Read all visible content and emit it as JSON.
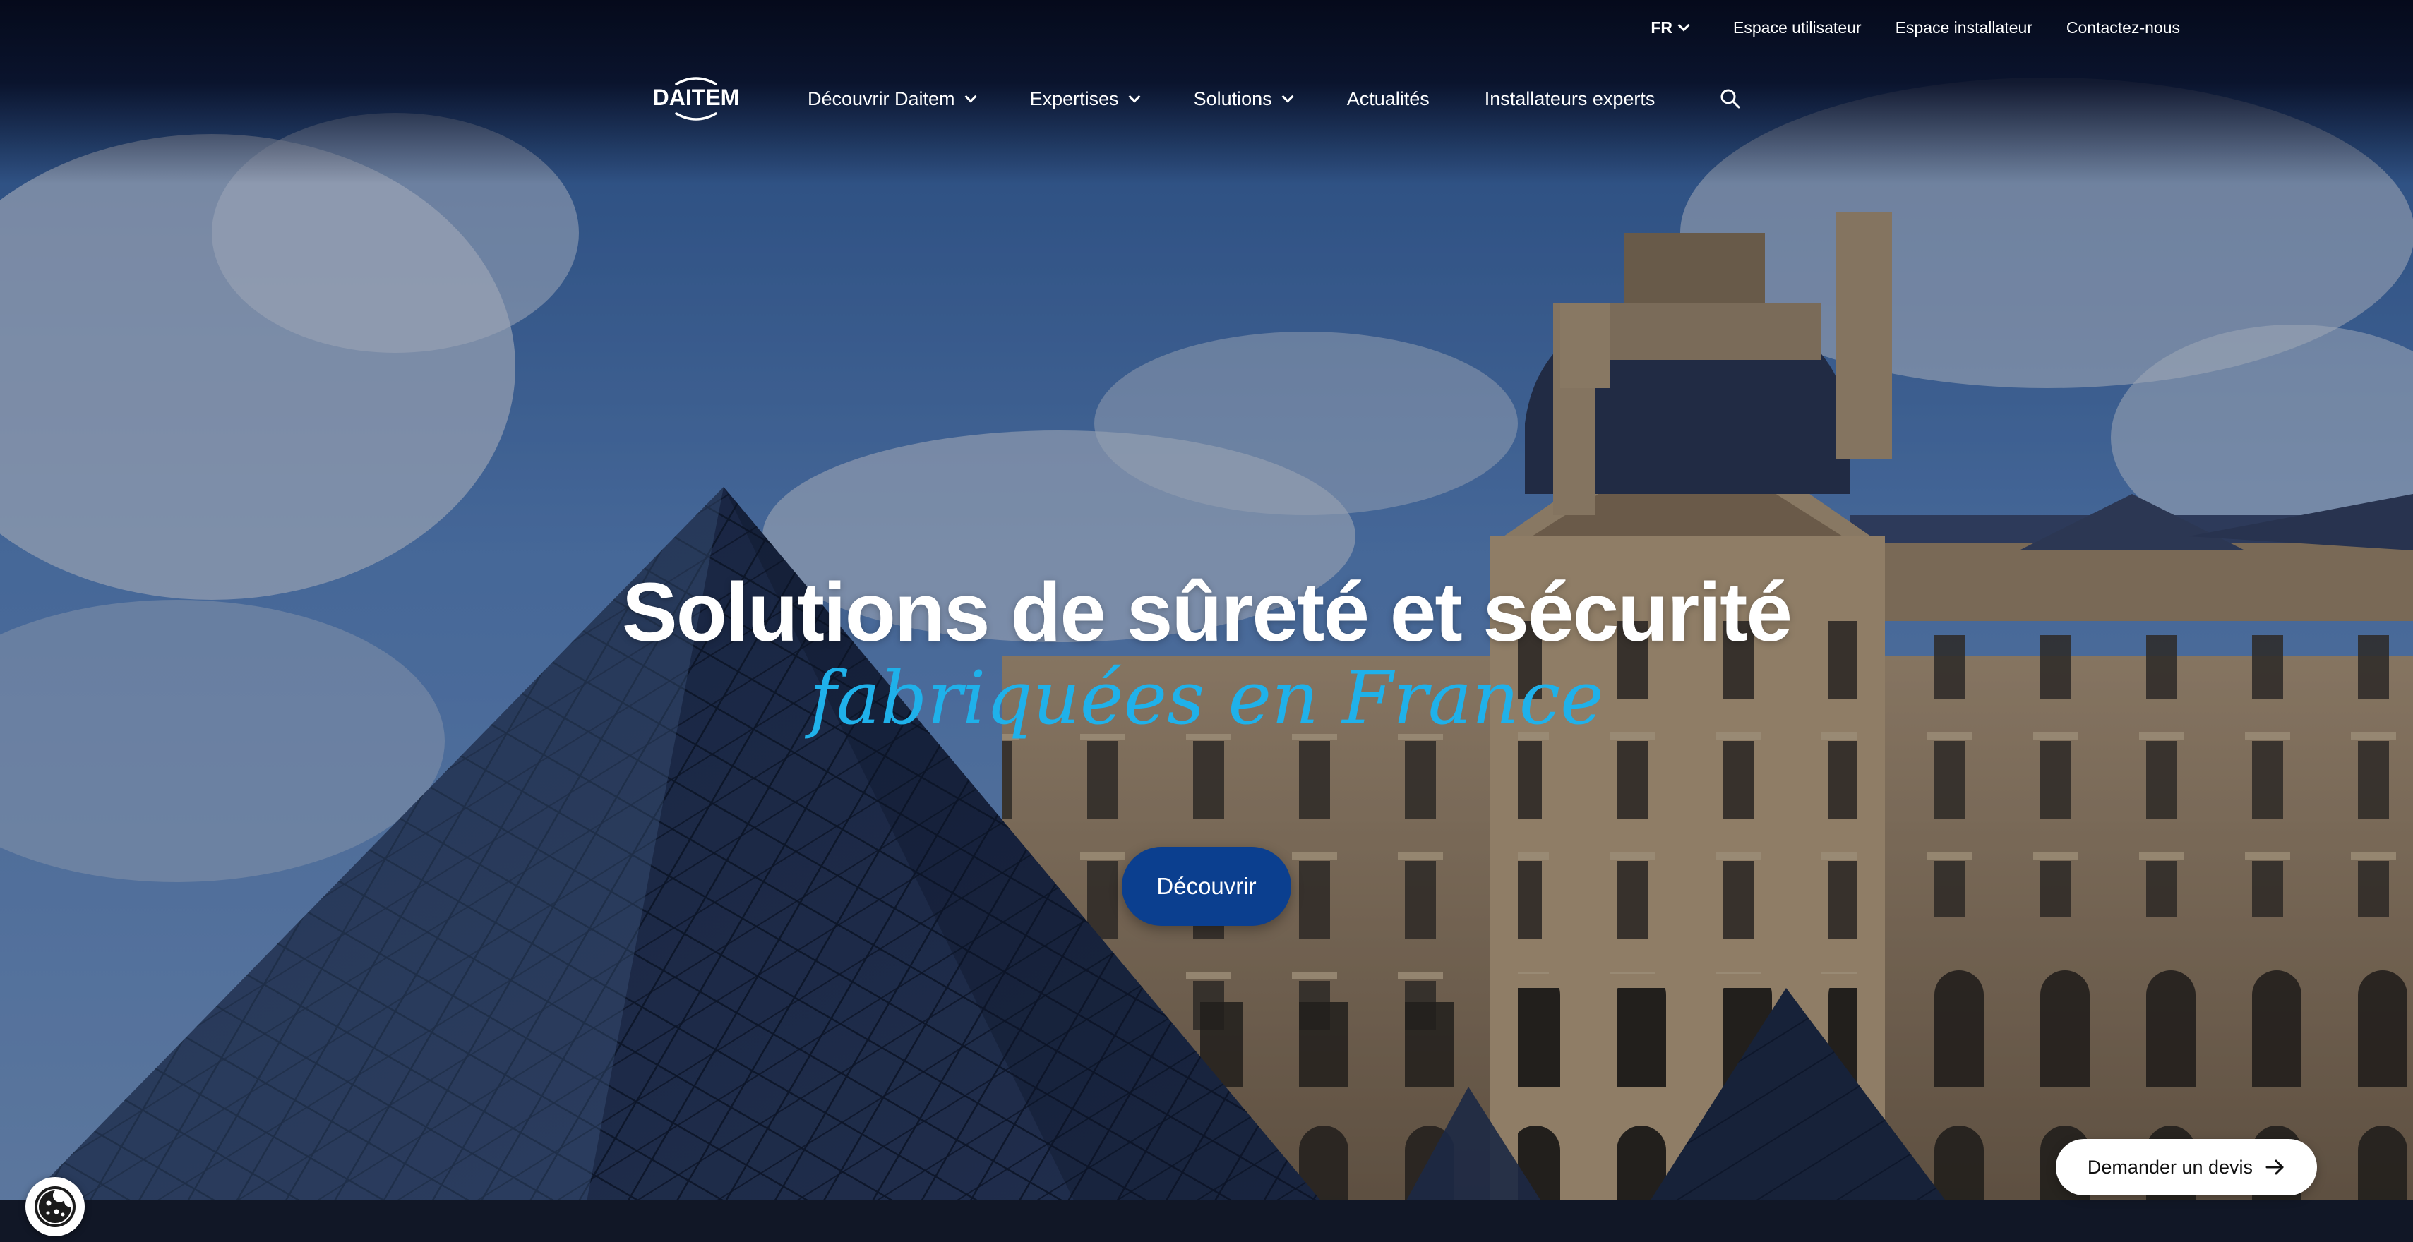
{
  "utility_nav": {
    "language": "FR",
    "links": [
      "Espace utilisateur",
      "Espace installateur",
      "Contactez-nous"
    ]
  },
  "brand": {
    "logo_text": "DAITEM"
  },
  "main_nav": {
    "items": [
      {
        "label": "Découvrir Daitem",
        "has_dropdown": true
      },
      {
        "label": "Expertises",
        "has_dropdown": true
      },
      {
        "label": "Solutions",
        "has_dropdown": true
      },
      {
        "label": "Actualités",
        "has_dropdown": false
      },
      {
        "label": "Installateurs experts",
        "has_dropdown": false
      }
    ],
    "search_icon": "search-icon"
  },
  "hero": {
    "title": "Solutions de sûreté et sécurité",
    "subtitle": "fabriquées en France",
    "cta_label": "Découvrir"
  },
  "floating": {
    "quote_button_label": "Demander un devis",
    "quote_icon": "arrow-right-icon",
    "cookie_icon": "cookie-icon"
  },
  "colors": {
    "subtitle_accent": "#1fb1ea",
    "cta_background": "#0b3f8f",
    "header_background": "#050a1c"
  }
}
